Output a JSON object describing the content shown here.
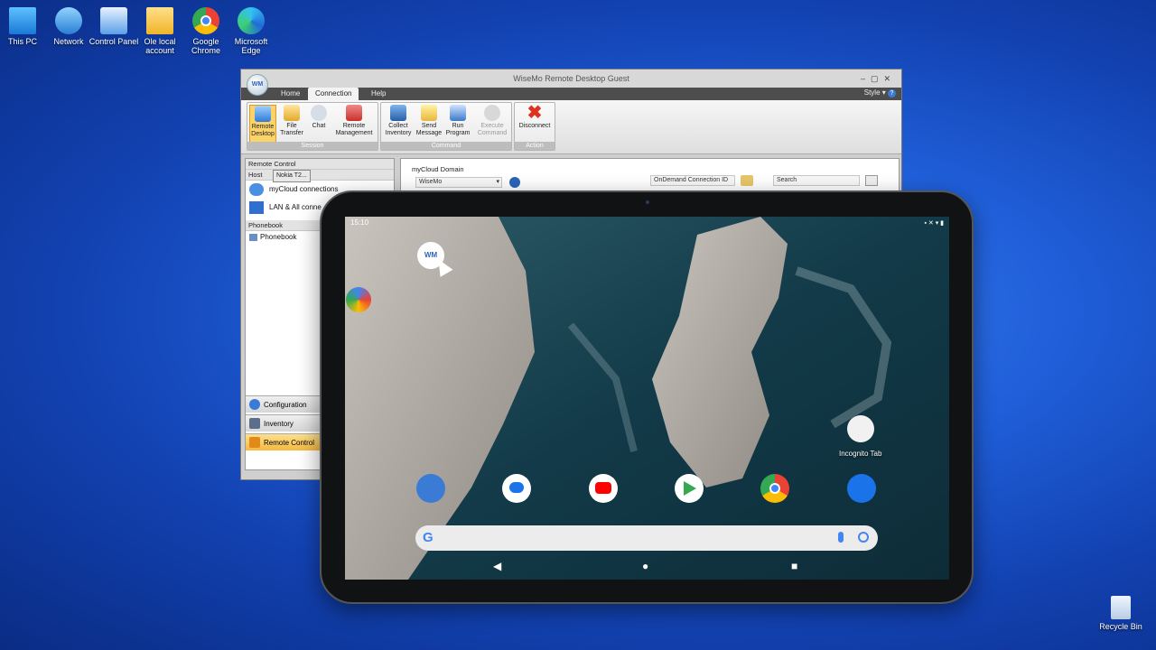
{
  "desktop": {
    "icons": [
      {
        "label": "This PC"
      },
      {
        "label": "Network"
      },
      {
        "label": "Control Panel"
      },
      {
        "label": "Ole local account"
      },
      {
        "label": "Google Chrome"
      },
      {
        "label": "Microsoft Edge"
      }
    ],
    "recycle_bin": "Recycle Bin"
  },
  "window": {
    "title": "WiseMo Remote Desktop Guest",
    "orb": "WM",
    "tabs": [
      "Home",
      "Connection",
      "Help"
    ],
    "style_label": "Style",
    "ribbon": {
      "session": {
        "label": "Session",
        "buttons": [
          "Remote Desktop",
          "File Transfer",
          "Chat",
          "Remote Management"
        ]
      },
      "command": {
        "label": "Command",
        "buttons": [
          "Collect Inventory",
          "Send Message",
          "Run Program",
          "Execute Command"
        ]
      },
      "action": {
        "label": "Action",
        "buttons": [
          "Disconnect"
        ]
      }
    },
    "left_pane": {
      "header": "Remote Control",
      "host_label": "Host",
      "tooltip": "Nokia T2...",
      "items": [
        "myCloud connections",
        "LAN & All conne"
      ],
      "phonebook_header": "Phonebook",
      "phonebook_item": "Phonebook",
      "nav": [
        "Configuration",
        "Inventory",
        "Remote Control"
      ]
    },
    "main_pane": {
      "group_label": "myCloud Domain",
      "domain_value": "WiseMo",
      "ondemand_label": "OnDemand Connection ID",
      "search_placeholder": "Search"
    }
  },
  "tablet": {
    "status_time": "15:10",
    "incognito_label": "Incognito Tab",
    "shortcut_label": "WM"
  }
}
